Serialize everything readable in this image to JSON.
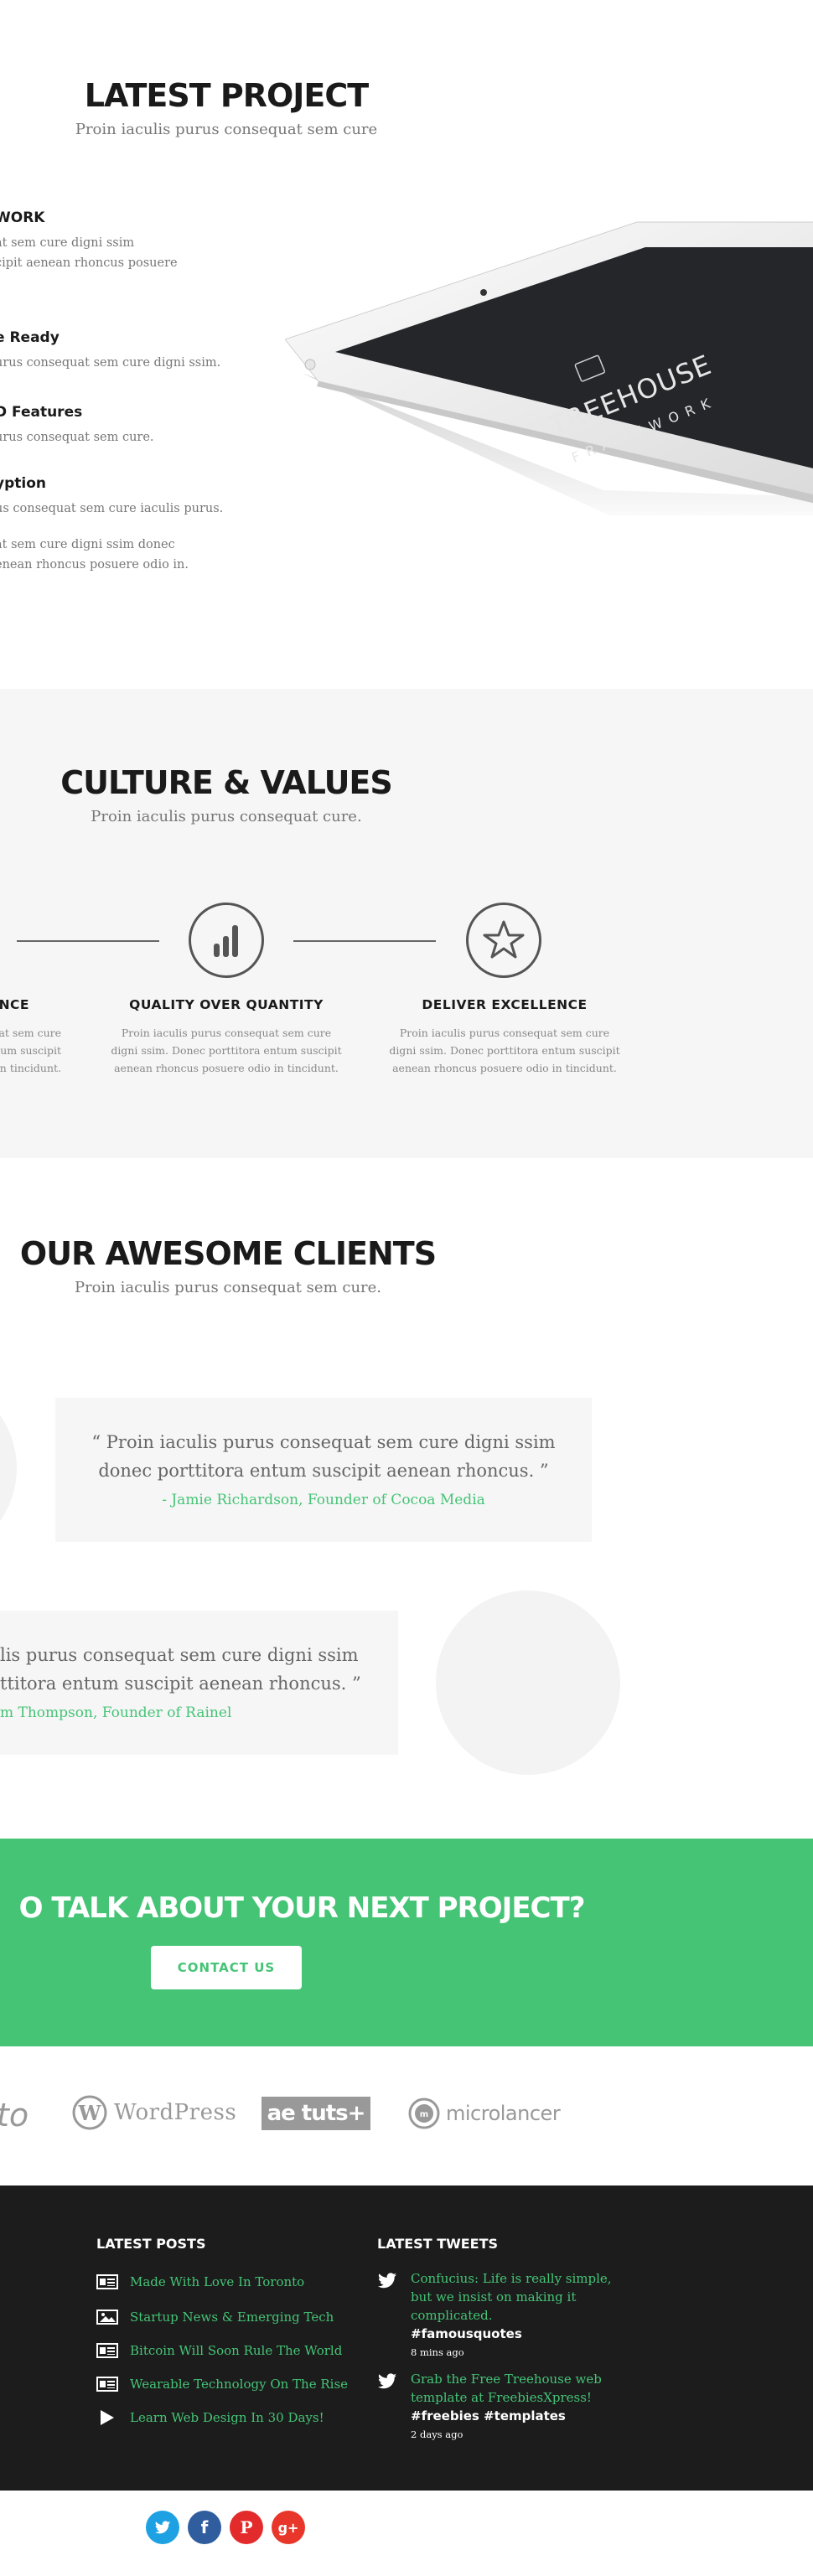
{
  "project": {
    "title": "LATEST PROJECT",
    "subtitle": "Proin iaculis purus consequat sem cure",
    "features": [
      {
        "title": "WORK",
        "text1": "at sem cure  digni ssim",
        "text2": "cipit  aenean rhoncus posuere"
      },
      {
        "title": "e Ready",
        "text1": "urus consequat sem cure  digni ssim.",
        "text2": ""
      },
      {
        "title": "D Features",
        "text1": "urus consequat sem cure.",
        "text2": ""
      },
      {
        "title": "yption",
        "text1": "us consequat sem cure iaculis purus.",
        "text2": ""
      },
      {
        "title": "",
        "text1": "at sem cure  digni ssim donec",
        "text2": "enean rhoncus posuere odio in."
      }
    ],
    "tablet": {
      "brand": "TREEHOUSE",
      "tagline": "FRAMEWORK"
    }
  },
  "culture": {
    "title": "CULTURE & VALUES",
    "subtitle": "Proin iaculis purus consequat cure.",
    "values": [
      {
        "title": "NCE",
        "icon": "heart-icon",
        "line1": "at sem cure",
        "line2": "ntum suscipit",
        "line3": "o in tincidunt."
      },
      {
        "title": "QUALITY OVER QUANTITY",
        "icon": "bar-chart-icon",
        "line1": "Proin iaculis purus consequat sem cure",
        "line2": "digni ssim. Donec porttitora entum suscipit",
        "line3": "aenean rhoncus posuere odio in tincidunt."
      },
      {
        "title": "DELIVER EXCELLENCE",
        "icon": "star-icon",
        "line1": "Proin iaculis purus consequat sem cure",
        "line2": "digni ssim. Donec porttitora entum suscipit",
        "line3": "aenean rhoncus posuere odio in tincidunt."
      }
    ]
  },
  "clients": {
    "title": "OUR AWESOME CLIENTS",
    "subtitle": "Proin iaculis purus consequat sem cure.",
    "testimonials": [
      {
        "line1": "“ Proin iaculis purus consequat sem cure  digni ssim",
        "line2": "donec porttitora entum suscipit aenean rhoncus. ”",
        "author": "- Jamie Richardson, Founder of Cocoa Media"
      },
      {
        "line1": "lis purus consequat sem cure  digni ssim",
        "line2": "ttitora entum suscipit aenean rhoncus. ”",
        "author": "m Thompson, Founder of Rainel"
      }
    ]
  },
  "cta": {
    "heading": "O TALK ABOUT YOUR NEXT PROJECT?",
    "button": "CONTACT US"
  },
  "logos": {
    "items": [
      "to",
      "WordPress",
      "ae tuts+",
      "microlancer"
    ]
  },
  "footer": {
    "posts_title": "LATEST POSTS",
    "tweets_title": "LATEST TWEETS",
    "posts": [
      {
        "label": "Made With Love In Toronto",
        "icon": "article-icon"
      },
      {
        "label": "Startup News & Emerging Tech",
        "icon": "image-icon"
      },
      {
        "label": "Bitcoin Will Soon Rule The World",
        "icon": "article-icon"
      },
      {
        "label": "Wearable Technology On The Rise",
        "icon": "article-icon"
      },
      {
        "label": "Learn Web Design In 30 Days!",
        "icon": "play-icon"
      }
    ],
    "tweets": [
      {
        "line1": "Confucius: Life is really simple,",
        "line2": "but we insist on making it",
        "line3": "complicated.",
        "tags": "#famousquotes",
        "time": "8 mins ago"
      },
      {
        "line1": "Grab the Free Treehouse web",
        "line2": "template at FreebiesXpress!",
        "line3": "",
        "tags": "#freebies #templates",
        "time": "2 days ago"
      }
    ]
  },
  "social": {
    "items": [
      {
        "name": "twitter",
        "glyph": "t",
        "color": "#1da1e3"
      },
      {
        "name": "facebook",
        "glyph": "f",
        "color": "#2f5d9e"
      },
      {
        "name": "pinterest",
        "glyph": "P",
        "color": "#e32b2b"
      },
      {
        "name": "google-plus",
        "glyph": "g+",
        "color": "#e8362a"
      }
    ]
  },
  "colors": {
    "accent": "#45c476",
    "dark": "#1c1c1c",
    "light_bg": "#f6f6f6"
  }
}
